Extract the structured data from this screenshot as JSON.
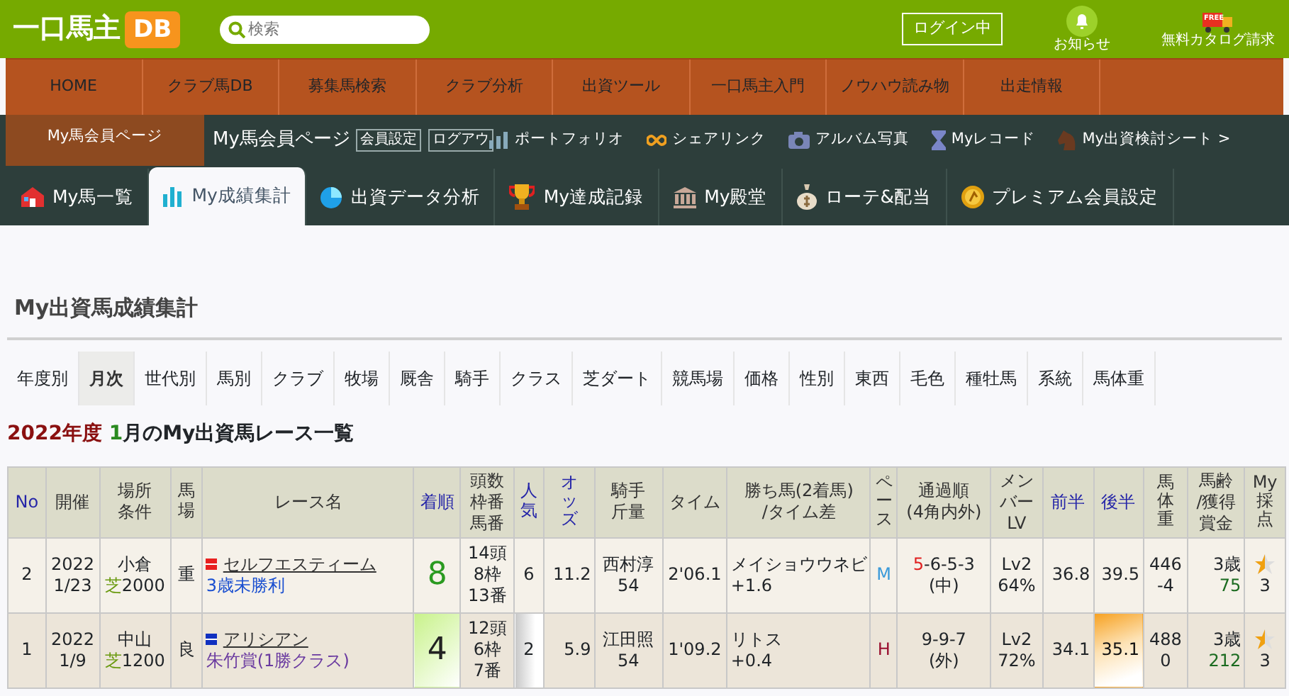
{
  "header": {
    "logo_text": "一口馬主",
    "logo_badge": "DB",
    "search": {
      "placeholder": "検索"
    },
    "login_button": "ログイン中",
    "actions": [
      {
        "kind": "bell",
        "label": "お知らせ"
      },
      {
        "kind": "catalog",
        "label": "無料カタログ請求",
        "badge": "FREE"
      }
    ]
  },
  "main_nav": [
    {
      "label": "HOME"
    },
    {
      "label": "クラブ馬DB"
    },
    {
      "label": "募集馬検索"
    },
    {
      "label": "クラブ分析"
    },
    {
      "label": "出資ツール"
    },
    {
      "label": "一口馬主入門"
    },
    {
      "label": "ノウハウ読み物"
    },
    {
      "label": "出走情報"
    }
  ],
  "member_bar": {
    "side_label": "My馬会員ページ",
    "title": "My馬会員ページ",
    "buttons": [
      "会員設定",
      "ログアウ"
    ],
    "links": [
      {
        "kind": "portfolio",
        "label": "ポートフォリオ"
      },
      {
        "kind": "infinity",
        "label": "シェアリンク"
      },
      {
        "kind": "camera",
        "label": "アルバム写真"
      },
      {
        "kind": "hourglass",
        "label": "Myレコード"
      },
      {
        "kind": "horse",
        "label": "My出資検討シート >"
      }
    ]
  },
  "tabs": [
    {
      "kind": "house",
      "label": "My馬一覧",
      "selected": false
    },
    {
      "kind": "bars",
      "label": "My成績集計",
      "selected": true
    },
    {
      "kind": "pie",
      "label": "出資データ分析",
      "selected": false
    },
    {
      "kind": "trophy",
      "label": "My達成記録",
      "selected": false
    },
    {
      "kind": "museum",
      "label": "My殿堂",
      "selected": false
    },
    {
      "kind": "moneybag",
      "label": "ローテ&配当",
      "selected": false
    },
    {
      "kind": "coin",
      "label": "プレミアム会員設定",
      "selected": false
    }
  ],
  "page_title": "My出資馬成績集計",
  "filters": [
    {
      "label": "年度別",
      "selected": false
    },
    {
      "label": "月次",
      "selected": true
    },
    {
      "label": "世代別",
      "selected": false
    },
    {
      "label": "馬別",
      "selected": false
    },
    {
      "label": "クラブ",
      "selected": false
    },
    {
      "label": "牧場",
      "selected": false
    },
    {
      "label": "厩舎",
      "selected": false
    },
    {
      "label": "騎手",
      "selected": false
    },
    {
      "label": "クラス",
      "selected": false
    },
    {
      "label": "芝ダート",
      "selected": false
    },
    {
      "label": "競馬場",
      "selected": false
    },
    {
      "label": "価格",
      "selected": false
    },
    {
      "label": "性別",
      "selected": false
    },
    {
      "label": "東西",
      "selected": false
    },
    {
      "label": "毛色",
      "selected": false
    },
    {
      "label": "種牡馬",
      "selected": false
    },
    {
      "label": "系統",
      "selected": false
    },
    {
      "label": "馬体重",
      "selected": false
    }
  ],
  "subtitle": {
    "year": "2022年度",
    "month": "1",
    "rest": "月のMy出資馬レース一覧"
  },
  "table": {
    "columns": [
      {
        "label": "No",
        "sortable": true
      },
      {
        "label": "開催",
        "sortable": false
      },
      {
        "lines": [
          "場所",
          "条件"
        ],
        "sortable": false
      },
      {
        "label": "馬場",
        "kind": "vertical",
        "sortable": false
      },
      {
        "label": "レース名",
        "sortable": false
      },
      {
        "label": "着順",
        "sortable": true
      },
      {
        "lines": [
          "頭数",
          "枠番",
          "馬番"
        ],
        "sortable": false
      },
      {
        "label": "人気",
        "kind": "vertical",
        "sortable": true
      },
      {
        "label": "オッズ",
        "kind": "vertical",
        "sortable": true
      },
      {
        "lines": [
          "騎手",
          "斤量"
        ],
        "sortable": false
      },
      {
        "label": "タイム",
        "sortable": false
      },
      {
        "lines": [
          "勝ち馬(2着馬)",
          "/タイム差"
        ],
        "sortable": false
      },
      {
        "label": "ペース",
        "kind": "vertical",
        "sortable": false
      },
      {
        "lines": [
          "通過順",
          "(4角内外)"
        ],
        "sortable": false
      },
      {
        "lines": [
          "メン",
          "バー",
          "LV"
        ],
        "sortable": false
      },
      {
        "label": "前半",
        "sortable": true
      },
      {
        "label": "後半",
        "sortable": true
      },
      {
        "label": "馬体重",
        "kind": "vertical",
        "sortable": false
      },
      {
        "lines": [
          "馬齢",
          "/獲得",
          "賞金"
        ],
        "sortable": false
      },
      {
        "label": "My採点",
        "kind": "vertical",
        "sortable": false
      }
    ],
    "rows": [
      {
        "no": "2",
        "date": [
          "2022",
          "1/23"
        ],
        "venue": "小倉",
        "surface": "芝",
        "distance": "2000",
        "going": "重",
        "frame": {
          "color": "#e82020"
        },
        "horse": "セルフエスティーム",
        "race": {
          "text": "3歳未勝利",
          "color": "#1a4fd0"
        },
        "finish": "8",
        "finish_highlight": false,
        "field": [
          "14頭",
          "8枠",
          "13番"
        ],
        "popularity": "6",
        "popularity_highlight": false,
        "odds": "11.2",
        "jockey": [
          "西村淳",
          "54"
        ],
        "time": "2'06.1",
        "winner": [
          "メイショウウネビ",
          "+1.6"
        ],
        "pace": {
          "text": "M",
          "color": "#3a9ad9"
        },
        "passing_first": "5",
        "passing_first_highlight": true,
        "passing_rest": "-6-5-3",
        "passing_side": "(中)",
        "member": [
          "Lv2",
          "64%"
        ],
        "first_half": "36.8",
        "second_half": "39.5",
        "second_half_highlight": false,
        "weight": [
          "446",
          "-4"
        ],
        "age": "3歳",
        "earnings": "75",
        "score": "3"
      },
      {
        "no": "1",
        "date": [
          "2022",
          "1/9"
        ],
        "venue": "中山",
        "surface": "芝",
        "distance": "1200",
        "going": "良",
        "frame": {
          "color": "#1030c0"
        },
        "horse": "アリシアン",
        "race": {
          "text": "朱竹賞(1勝クラス)",
          "color": "#6a3aa0"
        },
        "finish": "4",
        "finish_highlight": true,
        "field": [
          "12頭",
          "6枠",
          "7番"
        ],
        "popularity": "2",
        "popularity_highlight": true,
        "odds": "5.9",
        "jockey": [
          "江田照",
          "54"
        ],
        "time": "1'09.2",
        "winner": [
          "リトス",
          "+0.4"
        ],
        "pace": {
          "text": "H",
          "color": "#9a1030"
        },
        "passing_first": "9",
        "passing_first_highlight": false,
        "passing_rest": "-9-7",
        "passing_side": "(外)",
        "member": [
          "Lv2",
          "72%"
        ],
        "first_half": "34.1",
        "second_half": "35.1",
        "second_half_highlight": true,
        "weight": [
          "488",
          "0"
        ],
        "age": "3歳",
        "earnings": "212",
        "score": "3"
      }
    ]
  }
}
